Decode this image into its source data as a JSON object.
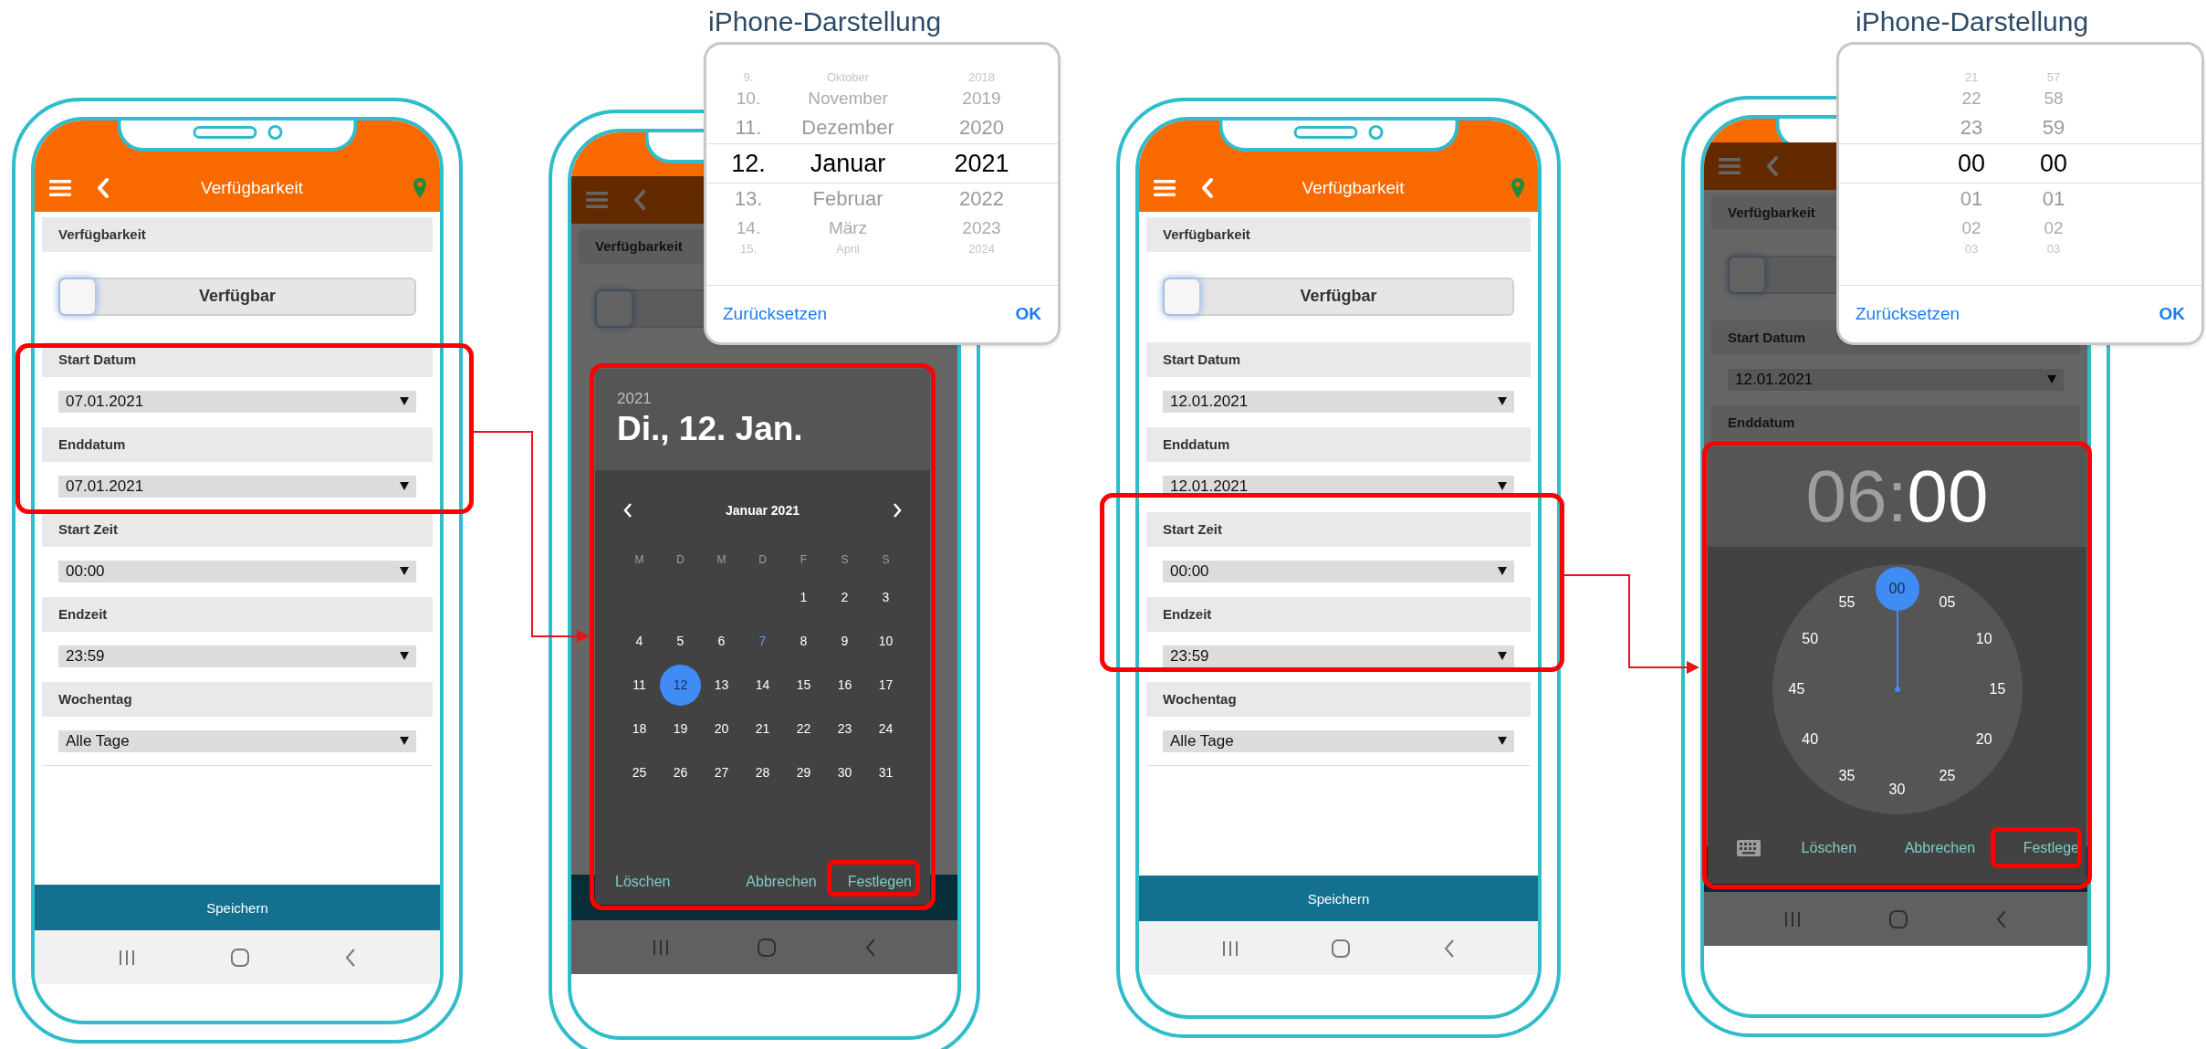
{
  "phones": [
    {
      "dimmed": false,
      "title": "Verfügbarkeit",
      "form": [
        {
          "kind": "label",
          "text": "Verfügbarkeit"
        },
        {
          "kind": "toggle",
          "text": "Verfügbar",
          "on": false
        },
        {
          "kind": "label",
          "text": "Start Datum"
        },
        {
          "kind": "select",
          "value": "07.01.2021"
        },
        {
          "kind": "label",
          "text": "Enddatum"
        },
        {
          "kind": "select",
          "value": "07.01.2021"
        },
        {
          "kind": "label",
          "text": "Start Zeit"
        },
        {
          "kind": "select",
          "value": "00:00"
        },
        {
          "kind": "label",
          "text": "Endzeit"
        },
        {
          "kind": "select",
          "value": "23:59"
        },
        {
          "kind": "label",
          "text": "Wochentag"
        },
        {
          "kind": "select",
          "value": "Alle Tage"
        }
      ],
      "save": "Speichern"
    },
    {
      "dimmed": true,
      "form": [
        {
          "kind": "label",
          "text": "Verfügbarkeit"
        },
        {
          "kind": "toggle",
          "on": false
        }
      ]
    },
    {
      "dimmed": false,
      "title": "Verfügbarkeit",
      "form": [
        {
          "kind": "label",
          "text": "Verfügbarkeit"
        },
        {
          "kind": "toggle",
          "text": "Verfügbar",
          "on": false
        },
        {
          "kind": "label",
          "text": "Start Datum"
        },
        {
          "kind": "select",
          "value": "12.01.2021"
        },
        {
          "kind": "label",
          "text": "Enddatum"
        },
        {
          "kind": "select",
          "value": "12.01.2021"
        },
        {
          "kind": "label",
          "text": "Start Zeit"
        },
        {
          "kind": "select",
          "value": "00:00"
        },
        {
          "kind": "label",
          "text": "Endzeit"
        },
        {
          "kind": "select",
          "value": "23:59"
        },
        {
          "kind": "label",
          "text": "Wochentag"
        },
        {
          "kind": "select",
          "value": "Alle Tage"
        }
      ],
      "save": "Speichern"
    },
    {
      "dimmed": true,
      "form": [
        {
          "kind": "label",
          "text": "Verfügbarkeit"
        },
        {
          "kind": "toggle",
          "on": false
        },
        {
          "kind": "label",
          "text": "Start Datum"
        },
        {
          "kind": "select",
          "value": "12.01.2021"
        },
        {
          "kind": "label",
          "text": "Enddatum"
        }
      ]
    }
  ],
  "pickers": [
    {
      "caption": "iPhone-Darstellung",
      "rows": [
        {
          "cells": [
            "9.",
            "Oktober",
            "2018"
          ],
          "selected": false
        },
        {
          "cells": [
            "10.",
            "November",
            "2019"
          ],
          "selected": false
        },
        {
          "cells": [
            "11.",
            "Dezember",
            "2020"
          ],
          "selected": false
        },
        {
          "cells": [
            "12.",
            "Januar",
            "2021"
          ],
          "selected": true
        },
        {
          "cells": [
            "13.",
            "Februar",
            "2022"
          ],
          "selected": false
        },
        {
          "cells": [
            "14.",
            "März",
            "2023"
          ],
          "selected": false
        },
        {
          "cells": [
            "15.",
            "April",
            "2024"
          ],
          "selected": false
        }
      ],
      "reset": "Zurücksetzen",
      "ok": "OK"
    },
    {
      "caption": "iPhone-Darstellung",
      "rows": [
        {
          "cells": [
            "21",
            "57"
          ],
          "selected": false
        },
        {
          "cells": [
            "22",
            "58"
          ],
          "selected": false
        },
        {
          "cells": [
            "23",
            "59"
          ],
          "selected": false
        },
        {
          "cells": [
            "00",
            "00"
          ],
          "selected": true
        },
        {
          "cells": [
            "01",
            "01"
          ],
          "selected": false
        },
        {
          "cells": [
            "02",
            "02"
          ],
          "selected": false
        },
        {
          "cells": [
            "03",
            "03"
          ],
          "selected": false
        }
      ],
      "reset": "Zurücksetzen",
      "ok": "OK"
    }
  ],
  "date_dialog": {
    "year": "2021",
    "date": "Di., 12. Jan.",
    "month": "Januar 2021",
    "weekdays": [
      "M",
      "D",
      "M",
      "D",
      "F",
      "S",
      "S"
    ],
    "weeks": [
      [
        {
          "day": "1",
          "selected": false,
          "today": false
        },
        {
          "day": "2",
          "selected": false,
          "today": false
        },
        {
          "day": "3",
          "selected": false,
          "today": false
        }
      ],
      [
        {
          "day": "4",
          "selected": false,
          "today": false
        },
        {
          "day": "5",
          "selected": false,
          "today": false
        },
        {
          "day": "6",
          "selected": false,
          "today": false
        },
        {
          "day": "7",
          "selected": false,
          "today": true
        },
        {
          "day": "8",
          "selected": false,
          "today": false
        },
        {
          "day": "9",
          "selected": false,
          "today": false
        },
        {
          "day": "10",
          "selected": false,
          "today": false
        }
      ],
      [
        {
          "day": "11",
          "selected": false,
          "today": false
        },
        {
          "day": "12",
          "selected": true,
          "today": false
        },
        {
          "day": "13",
          "selected": false,
          "today": false
        },
        {
          "day": "14",
          "selected": false,
          "today": false
        },
        {
          "day": "15",
          "selected": false,
          "today": false
        },
        {
          "day": "16",
          "selected": false,
          "today": false
        },
        {
          "day": "17",
          "selected": false,
          "today": false
        }
      ],
      [
        {
          "day": "18",
          "selected": false,
          "today": false
        },
        {
          "day": "19",
          "selected": false,
          "today": false
        },
        {
          "day": "20",
          "selected": false,
          "today": false
        },
        {
          "day": "21",
          "selected": false,
          "today": false
        },
        {
          "day": "22",
          "selected": false,
          "today": false
        },
        {
          "day": "23",
          "selected": false,
          "today": false
        },
        {
          "day": "24",
          "selected": false,
          "today": false
        }
      ],
      [
        {
          "day": "25",
          "selected": false,
          "today": false
        },
        {
          "day": "26",
          "selected": false,
          "today": false
        },
        {
          "day": "27",
          "selected": false,
          "today": false
        },
        {
          "day": "28",
          "selected": false,
          "today": false
        },
        {
          "day": "29",
          "selected": false,
          "today": false
        },
        {
          "day": "30",
          "selected": false,
          "today": false
        },
        {
          "day": "31",
          "selected": false,
          "today": false
        }
      ]
    ],
    "buttons": [
      "Löschen",
      "Abbrechen",
      "Festlegen"
    ]
  },
  "time_dialog": {
    "parts": [
      {
        "text": "06",
        "selected": false
      },
      {
        "text": ":",
        "selected": false
      },
      {
        "text": "00",
        "selected": true
      }
    ],
    "dial": [
      {
        "label": "00",
        "selected": true
      },
      {
        "label": "05",
        "selected": false
      },
      {
        "label": "10",
        "selected": false
      },
      {
        "label": "15",
        "selected": false
      },
      {
        "label": "20",
        "selected": false
      },
      {
        "label": "25",
        "selected": false
      },
      {
        "label": "30",
        "selected": false
      },
      {
        "label": "35",
        "selected": false
      },
      {
        "label": "40",
        "selected": false
      },
      {
        "label": "45",
        "selected": false
      },
      {
        "label": "50",
        "selected": false
      },
      {
        "label": "55",
        "selected": false
      }
    ],
    "buttons": [
      "Löschen",
      "Abbrechen",
      "Festlege"
    ]
  }
}
